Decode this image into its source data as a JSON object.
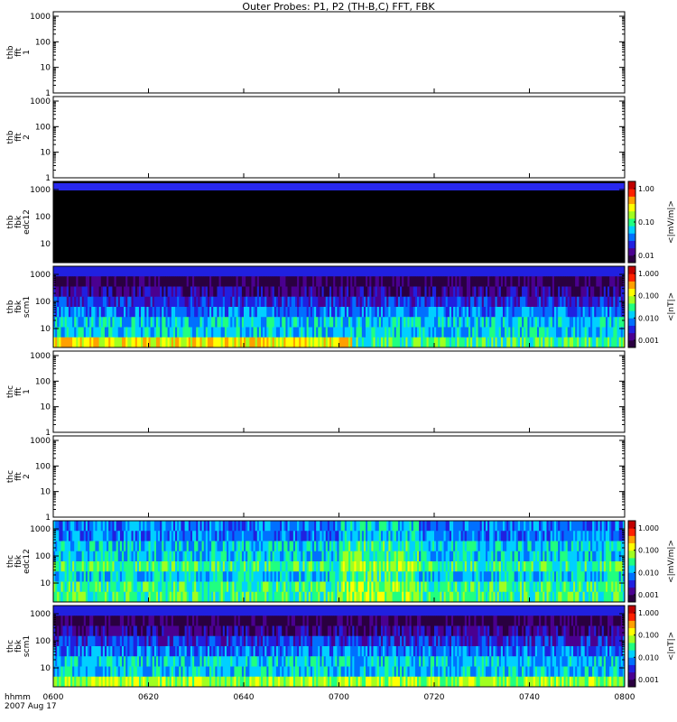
{
  "title": "Outer Probes: P1, P2 (TH-B,C) FFT, FBK",
  "time_axis": {
    "prefix_top": "hhmm",
    "prefix_bottom": "2007 Aug 17",
    "ticks": [
      "0600",
      "0620",
      "0640",
      "0700",
      "0720",
      "0740",
      "0800"
    ]
  },
  "chart_data": [
    {
      "type": "line",
      "panel": "thb-fft1",
      "ylabel": [
        "thb",
        "fft",
        "1"
      ],
      "yticks": [
        "1",
        "10",
        "100",
        "1000"
      ],
      "ylim": [
        1,
        1500
      ],
      "log": true,
      "empty": true
    },
    {
      "type": "line",
      "panel": "thb-fft2",
      "ylabel": [
        "thb",
        "fft",
        "2"
      ],
      "yticks": [
        "1",
        "10",
        "100",
        "1000"
      ],
      "ylim": [
        1,
        1500
      ],
      "log": true,
      "empty": true
    },
    {
      "type": "heatmap",
      "panel": "thb-fbk-edc12",
      "ylabel": [
        "thb",
        "fbk",
        "edc12"
      ],
      "yticks": [
        "10",
        "100",
        "1000"
      ],
      "ylim": [
        2,
        2000
      ],
      "log": true,
      "colorbar": {
        "label": "<|mV/m|>",
        "ticks": [
          "0.01",
          "0.10",
          "1.00"
        ]
      },
      "bands": [
        {
          "color": "#2828ee",
          "level": "high"
        },
        {
          "color": "#000000",
          "level": "fill"
        }
      ]
    },
    {
      "type": "heatmap",
      "panel": "thb-fbk-scm1",
      "ylabel": [
        "thb",
        "fbk",
        "scm1"
      ],
      "yticks": [
        "10",
        "100",
        "1000"
      ],
      "ylim": [
        2,
        2000
      ],
      "log": true,
      "colorbar": {
        "label": "<|nT|>",
        "ticks": [
          "0.001",
          "0.010",
          "0.100",
          "1.000"
        ]
      }
    },
    {
      "type": "line",
      "panel": "thc-fft1",
      "ylabel": [
        "thc",
        "fft",
        "1"
      ],
      "yticks": [
        "1",
        "10",
        "100",
        "1000"
      ],
      "ylim": [
        1,
        1500
      ],
      "log": true,
      "empty": true
    },
    {
      "type": "line",
      "panel": "thc-fft2",
      "ylabel": [
        "thc",
        "fft",
        "2"
      ],
      "yticks": [
        "1",
        "10",
        "100",
        "1000"
      ],
      "ylim": [
        1,
        1500
      ],
      "log": true,
      "empty": true
    },
    {
      "type": "heatmap",
      "panel": "thc-fbk-edc12",
      "ylabel": [
        "thc",
        "fbk",
        "edc12"
      ],
      "yticks": [
        "10",
        "100",
        "1000"
      ],
      "ylim": [
        2,
        2000
      ],
      "log": true,
      "colorbar": {
        "label": "<|mV/m|>",
        "ticks": [
          "0.001",
          "0.010",
          "0.100",
          "1.000"
        ]
      }
    },
    {
      "type": "heatmap",
      "panel": "thc-fbk-scm1",
      "ylabel": [
        "thc",
        "fbk",
        "scm1"
      ],
      "yticks": [
        "10",
        "100",
        "1000"
      ],
      "ylim": [
        2,
        2000
      ],
      "log": true,
      "colorbar": {
        "label": "<|nT|>",
        "ticks": [
          "0.001",
          "0.010",
          "0.100",
          "1.000"
        ]
      }
    }
  ],
  "colors": {
    "scale": [
      "#2a0040",
      "#4a0090",
      "#2020e0",
      "#0070ff",
      "#00d0ff",
      "#20ff80",
      "#a0ff20",
      "#ffff00",
      "#ffa000",
      "#ff2000",
      "#c00000"
    ]
  }
}
